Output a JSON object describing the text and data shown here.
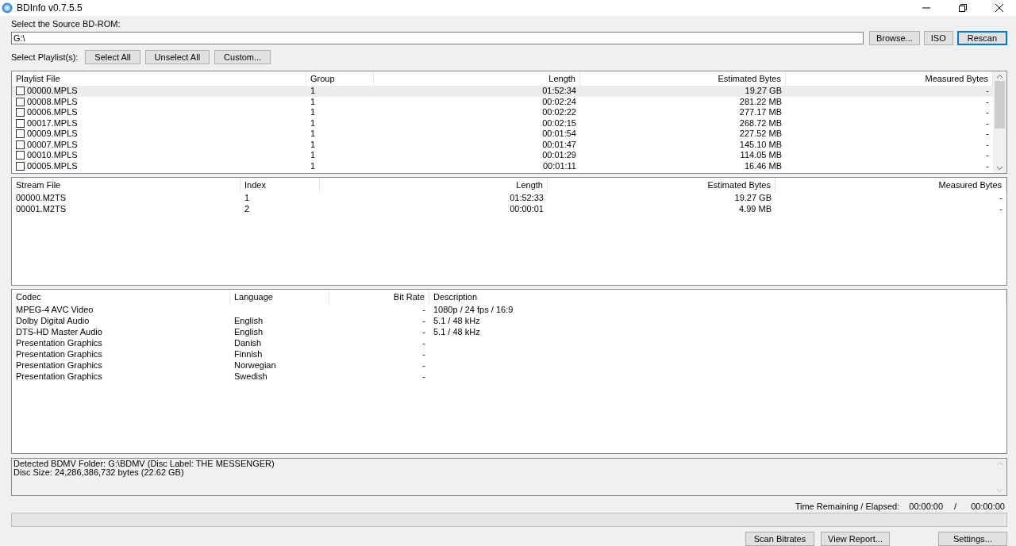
{
  "window": {
    "title": "BDInfo v0.7.5.5"
  },
  "source": {
    "label": "Select the Source BD-ROM:",
    "value": "G:\\",
    "buttons": [
      {
        "label": "Browse...",
        "focused": false
      },
      {
        "label": "ISO",
        "focused": false
      },
      {
        "label": "Rescan",
        "focused": true
      }
    ]
  },
  "playlist_select": {
    "label": "Select Playlist(s):",
    "buttons": [
      "Select All",
      "Unselect All",
      "Custom..."
    ]
  },
  "playlist_table": {
    "columns": [
      "Playlist File",
      "Group",
      "Length",
      "Estimated Bytes",
      "Measured Bytes"
    ],
    "rows": [
      {
        "file": "00000.MPLS",
        "group": "1",
        "length": "01:52:34",
        "estimated": "19.27 GB",
        "measured": "-",
        "checked": false,
        "selected": true
      },
      {
        "file": "00008.MPLS",
        "group": "1",
        "length": "00:02:24",
        "estimated": "281.22 MB",
        "measured": "-",
        "checked": false,
        "selected": false
      },
      {
        "file": "00006.MPLS",
        "group": "1",
        "length": "00:02:22",
        "estimated": "277.17 MB",
        "measured": "-",
        "checked": false,
        "selected": false
      },
      {
        "file": "00017.MPLS",
        "group": "1",
        "length": "00:02:15",
        "estimated": "268.72 MB",
        "measured": "-",
        "checked": false,
        "selected": false
      },
      {
        "file": "00009.MPLS",
        "group": "1",
        "length": "00:01:54",
        "estimated": "227.52 MB",
        "measured": "-",
        "checked": false,
        "selected": false
      },
      {
        "file": "00007.MPLS",
        "group": "1",
        "length": "00:01:47",
        "estimated": "145.10 MB",
        "measured": "-",
        "checked": false,
        "selected": false
      },
      {
        "file": "00010.MPLS",
        "group": "1",
        "length": "00:01:29",
        "estimated": "114.05 MB",
        "measured": "-",
        "checked": false,
        "selected": false
      },
      {
        "file": "00005.MPLS",
        "group": "1",
        "length": "00:01:11",
        "estimated": "16.46 MB",
        "measured": "-",
        "checked": false,
        "selected": false
      }
    ]
  },
  "stream_table": {
    "columns": [
      "Stream File",
      "Index",
      "Length",
      "Estimated Bytes",
      "Measured Bytes"
    ],
    "rows": [
      {
        "file": "00000.M2TS",
        "index": "1",
        "length": "01:52:33",
        "estimated": "19.27 GB",
        "measured": "-"
      },
      {
        "file": "00001.M2TS",
        "index": "2",
        "length": "00:00:01",
        "estimated": "4.99 MB",
        "measured": "-"
      }
    ]
  },
  "codec_table": {
    "columns": [
      "Codec",
      "Language",
      "Bit Rate",
      "Description"
    ],
    "rows": [
      {
        "codec": "MPEG-4 AVC Video",
        "language": "",
        "bitrate": "-",
        "description": "1080p / 24 fps / 16:9"
      },
      {
        "codec": "Dolby Digital Audio",
        "language": "English",
        "bitrate": "-",
        "description": "5.1 / 48 kHz"
      },
      {
        "codec": "DTS-HD Master Audio",
        "language": "English",
        "bitrate": "-",
        "description": "5.1 / 48 kHz"
      },
      {
        "codec": "Presentation Graphics",
        "language": "Danish",
        "bitrate": "-",
        "description": ""
      },
      {
        "codec": "Presentation Graphics",
        "language": "Finnish",
        "bitrate": "-",
        "description": ""
      },
      {
        "codec": "Presentation Graphics",
        "language": "Norwegian",
        "bitrate": "-",
        "description": ""
      },
      {
        "codec": "Presentation Graphics",
        "language": "Swedish",
        "bitrate": "-",
        "description": ""
      }
    ]
  },
  "log": [
    "Detected BDMV Folder: G:\\BDMV (Disc Label: THE MESSENGER)",
    "Disc Size: 24,286,386,732 bytes (22.62 GB)"
  ],
  "time": {
    "label": "Time Remaining / Elapsed:",
    "remaining": "00:00:00",
    "separator": "/",
    "elapsed": "00:00:00"
  },
  "progress": {
    "level": 0
  },
  "bottom_buttons": [
    {
      "label": "Scan Bitrates",
      "kind": "left"
    },
    {
      "label": "View Report...",
      "kind": "left"
    },
    {
      "label": "Settings...",
      "kind": "right"
    }
  ]
}
